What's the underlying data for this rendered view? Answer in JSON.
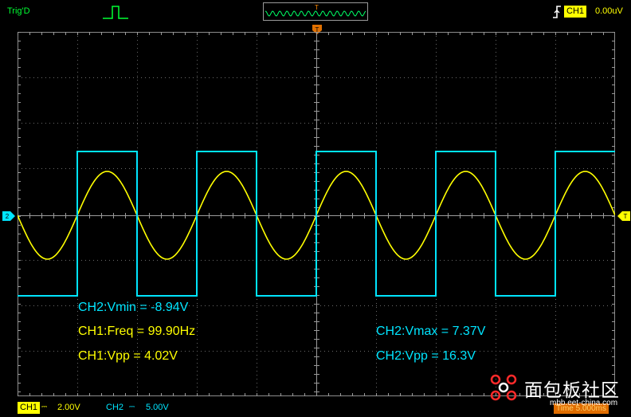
{
  "status": {
    "trigger_state": "Trig'D"
  },
  "trigger": {
    "source": "CH1",
    "level": "0.00uV",
    "marker_label": "T"
  },
  "channels": {
    "ch1": {
      "label": "CH1",
      "volts_div": "2.00V",
      "color": "#ffff00",
      "marker": "2"
    },
    "ch2": {
      "label": "CH2",
      "volts_div": "5.00V",
      "color": "#00e5ff"
    }
  },
  "timebase": {
    "time_div": "Time 5.000ms",
    "preview_marker": "T"
  },
  "right_marker": "T",
  "measurements": {
    "ch2_vmin": "CH2:Vmin = -8.94V",
    "ch1_freq": "CH1:Freq = 99.90Hz",
    "ch1_vpp": "CH1:Vpp = 4.02V",
    "ch2_vmax": "CH2:Vmax = 7.37V",
    "ch2_vpp": "CH2:Vpp = 16.3V"
  },
  "watermark": {
    "title": "面包板社区",
    "url": "mbb.eet-china.com"
  }
}
